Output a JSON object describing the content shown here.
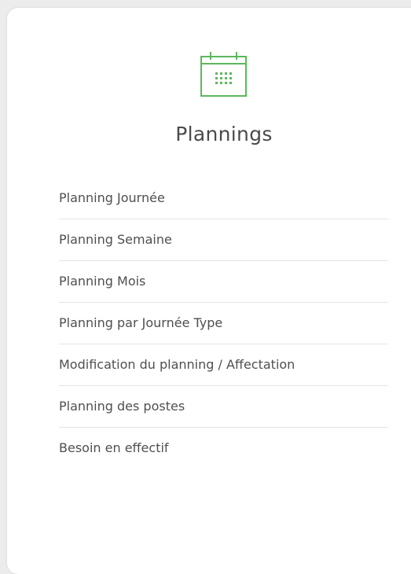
{
  "panel": {
    "icon": "calendar-icon",
    "accent_color": "#5cb85c",
    "title": "Plannings"
  },
  "menu": {
    "items": [
      {
        "label": "Planning Journée"
      },
      {
        "label": "Planning Semaine"
      },
      {
        "label": "Planning Mois"
      },
      {
        "label": "Planning par Journée Type"
      },
      {
        "label": "Modification du planning / Affectation"
      },
      {
        "label": "Planning des postes"
      },
      {
        "label": "Besoin en effectif"
      }
    ]
  }
}
